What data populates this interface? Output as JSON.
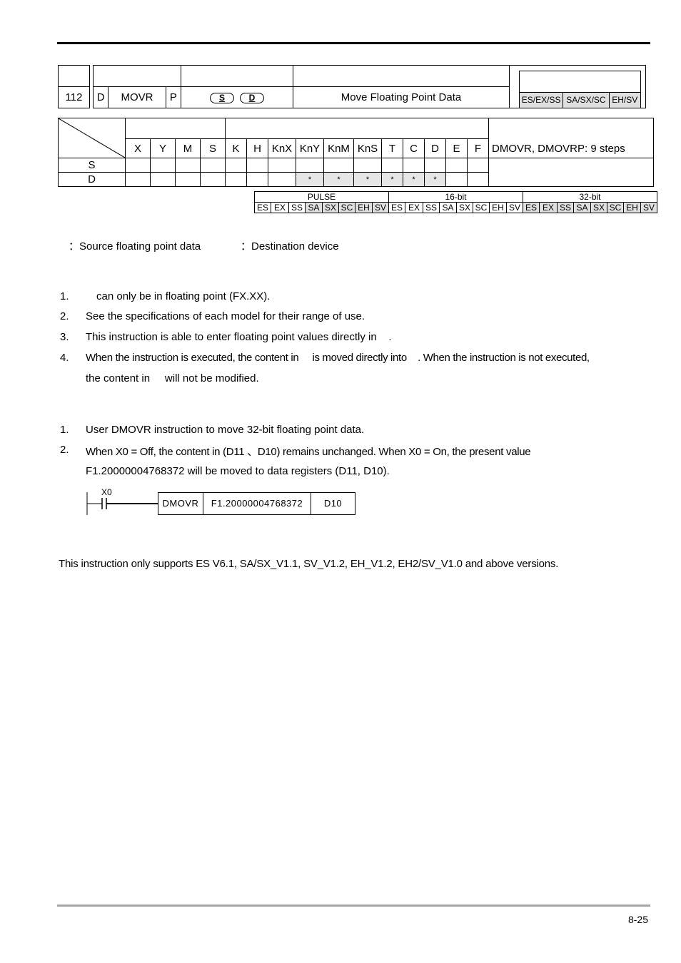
{
  "header": {
    "api_number": "112",
    "d_flag": "D",
    "mnemonic": "MOVR",
    "p_flag": "P",
    "operands": [
      "S",
      "D"
    ],
    "function": "Move Floating Point Data",
    "models": [
      "ES/EX/SS",
      "SA/SX/SC",
      "EH/SV"
    ]
  },
  "operand_table": {
    "columns": [
      "X",
      "Y",
      "M",
      "S",
      "K",
      "H",
      "KnX",
      "KnY",
      "KnM",
      "KnS",
      "T",
      "C",
      "D",
      "E",
      "F"
    ],
    "rows": [
      {
        "label": "S",
        "cells": [
          "",
          "",
          "",
          "",
          "",
          "",
          "",
          "",
          "",
          "",
          "",
          "",
          "",
          "",
          ""
        ]
      },
      {
        "label": "D",
        "cells": [
          "",
          "",
          "",
          "",
          "",
          "",
          "",
          "*",
          "*",
          "*",
          "*",
          "*",
          "*",
          "",
          ""
        ]
      }
    ],
    "steps": "DMOVR, DMOVRP: 9 steps"
  },
  "pulse_table": {
    "groups": [
      "PULSE",
      "16-bit",
      "32-bit"
    ],
    "models": [
      "ES",
      "EX",
      "SS",
      "SA",
      "SX",
      "SC",
      "EH",
      "SV"
    ],
    "shaded": {
      "PULSE": [
        false,
        false,
        false,
        true,
        true,
        true,
        true,
        true
      ],
      "16-bit": [
        false,
        false,
        false,
        false,
        false,
        false,
        false,
        false
      ],
      "32-bit": [
        true,
        true,
        true,
        true,
        true,
        true,
        true,
        true
      ]
    }
  },
  "operand_desc": {
    "s": "：Source floating point data",
    "d": "：Destination device"
  },
  "explanations": [
    {
      "n": "1.",
      "text": "can only be in floating point (FX.XX)."
    },
    {
      "n": "2.",
      "text": "See the specifications of each model for their range of use."
    },
    {
      "n": "3.",
      "text": "This instruction is able to enter floating point values directly in    ."
    },
    {
      "n": "4.",
      "text": "When the instruction is executed, the content in     is moved directly into    . When the instruction is not executed,",
      "cont": "the content in     will not be modified."
    }
  ],
  "examples": [
    {
      "n": "1.",
      "text": "User DMOVR instruction to move 32-bit floating point data."
    },
    {
      "n": "2.",
      "text": "When X0 = Off, the content in (D11 、D10) remains unchanged. When X0 = On, the present value",
      "cont": "F1.20000004768372 will be moved to data registers (D11, D10)."
    }
  ],
  "ladder": {
    "contact": "X0",
    "instruction": "DMOVR",
    "source": "F1.20000004768372",
    "dest": "D10"
  },
  "remarks": "This instruction only supports ES V6.1, SA/SX_V1.1, SV_V1.2, EH_V1.2, EH2/SV_V1.0 and above versions.",
  "page_number": "8-25"
}
